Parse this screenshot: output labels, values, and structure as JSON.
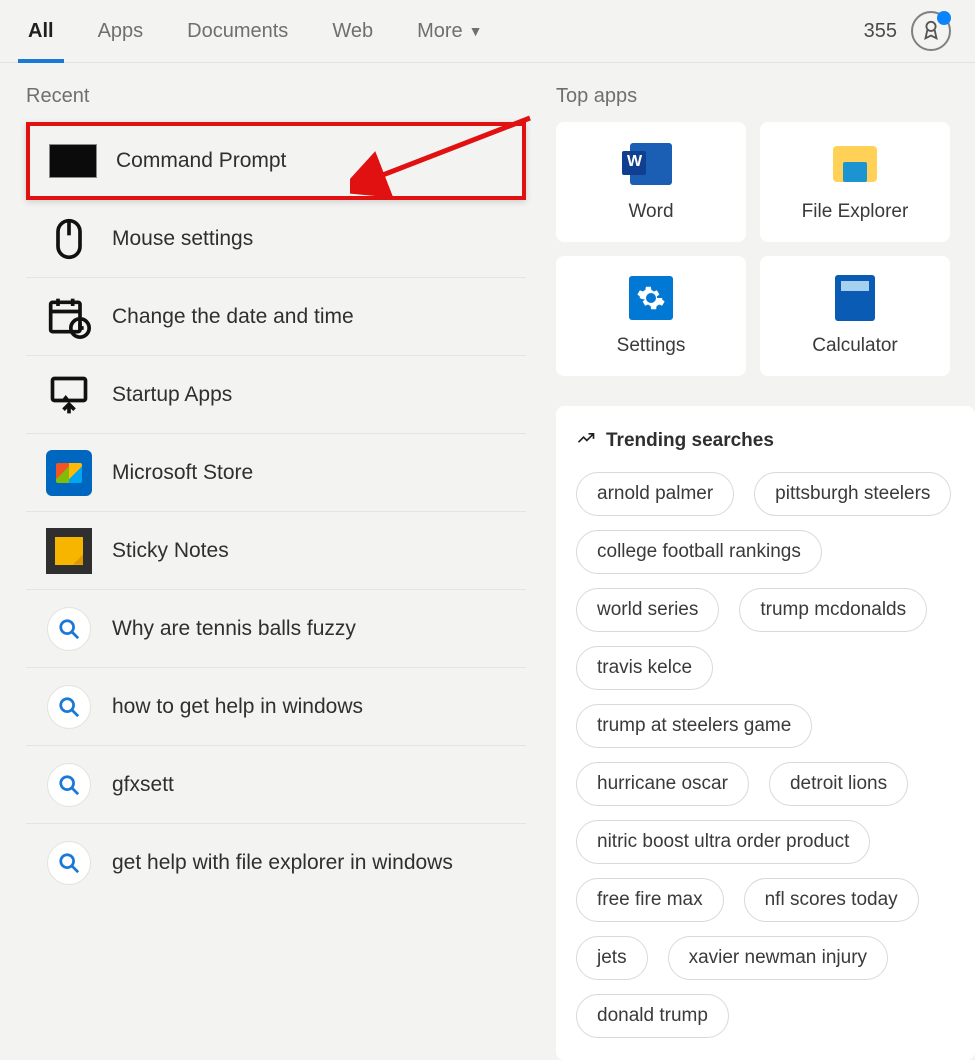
{
  "tabs": {
    "items": [
      {
        "label": "All",
        "active": true
      },
      {
        "label": "Apps"
      },
      {
        "label": "Documents"
      },
      {
        "label": "Web"
      },
      {
        "label": "More",
        "dropdown": true
      }
    ],
    "points": "355"
  },
  "recent": {
    "heading": "Recent",
    "items": [
      {
        "icon": "cmd",
        "label": "Command Prompt",
        "highlight": true
      },
      {
        "icon": "mouse",
        "label": "Mouse settings"
      },
      {
        "icon": "date",
        "label": "Change the date and time"
      },
      {
        "icon": "startup",
        "label": "Startup Apps"
      },
      {
        "icon": "store",
        "label": "Microsoft Store"
      },
      {
        "icon": "sticky",
        "label": "Sticky Notes"
      },
      {
        "icon": "search",
        "label": "Why are tennis balls fuzzy"
      },
      {
        "icon": "search",
        "label": "how to get help in windows"
      },
      {
        "icon": "search",
        "label": "gfxsett"
      },
      {
        "icon": "search",
        "label": "get help with file explorer in windows"
      }
    ]
  },
  "top_apps": {
    "heading": "Top apps",
    "items": [
      {
        "icon": "word",
        "label": "Word"
      },
      {
        "icon": "explorer",
        "label": "File Explorer"
      },
      {
        "icon": "settings",
        "label": "Settings"
      },
      {
        "icon": "calculator",
        "label": "Calculator"
      }
    ]
  },
  "trending": {
    "heading": "Trending searches",
    "items": [
      "arnold palmer",
      "pittsburgh steelers",
      "college football rankings",
      "world series",
      "trump mcdonalds",
      "travis kelce",
      "trump at steelers game",
      "hurricane oscar",
      "detroit lions",
      "nitric boost ultra order product",
      "free fire max",
      "nfl scores today",
      "jets",
      "xavier newman injury",
      "donald trump"
    ]
  }
}
